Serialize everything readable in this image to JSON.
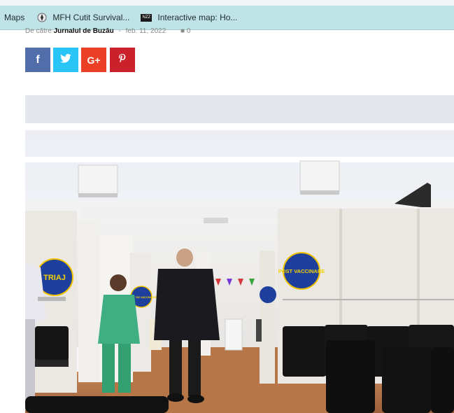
{
  "bookmarks_bar": {
    "items": [
      {
        "label": "Maps",
        "icon": "maps-icon"
      },
      {
        "label": "MFH Cutit Survival...",
        "icon": "compass-icon"
      },
      {
        "label": "Interactive map: Ho...",
        "icon": "nzz-icon",
        "icon_text": "NZZ"
      }
    ],
    "background": "#bfe3e7"
  },
  "article": {
    "byline_prefix": "De către",
    "author": "Jurnalul de Buzău",
    "separator": "-",
    "date": "feb. 11, 2022",
    "comment_count": "0"
  },
  "share_buttons": [
    {
      "network": "facebook",
      "glyph": "f",
      "color": "#516eab"
    },
    {
      "network": "twitter",
      "glyph": "twitter-bird",
      "color": "#29c5f6"
    },
    {
      "network": "google-plus",
      "glyph": "G+",
      "color": "#eb4026"
    },
    {
      "network": "pinterest",
      "glyph": "𝓅",
      "color": "#ca212a"
    }
  ],
  "photo": {
    "signs": {
      "triage": "TRIAJ",
      "vaccination_point": "PUNCT DE VACCINARE",
      "post_vaccination": "POST VACCINARE"
    }
  }
}
